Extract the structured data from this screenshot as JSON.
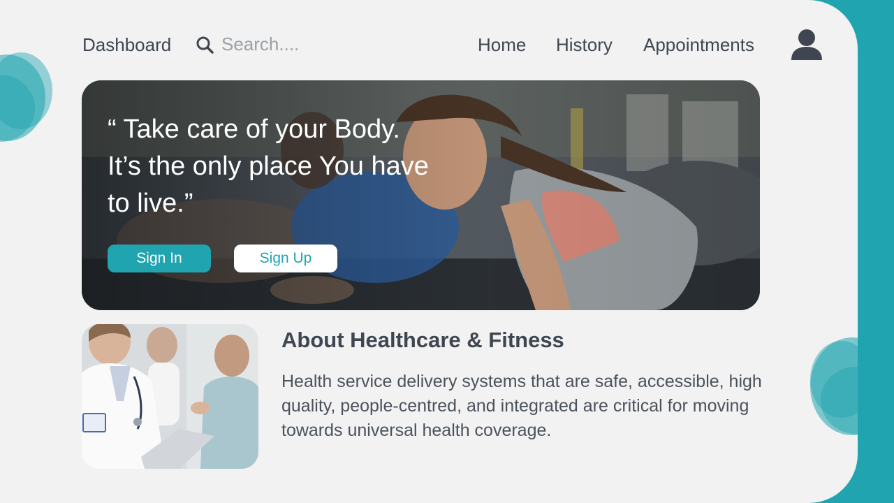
{
  "colors": {
    "accent": "#20a4b0",
    "panel": "#f2f2f2",
    "text": "#3f4651"
  },
  "nav": {
    "dashboard": "Dashboard",
    "search_placeholder": "Search....",
    "links": [
      "Home",
      "History",
      "Appointments"
    ],
    "user_icon": "user-icon"
  },
  "hero": {
    "quote": "“ Take care of your Body. It’s the only place You have to live.”",
    "sign_in": "Sign In",
    "sign_up": "Sign Up"
  },
  "about": {
    "title": "About Healthcare & Fitness",
    "body": "Health service delivery systems that are safe, accessible, high quality, people-centred, and integrated are critical for moving towards universal health coverage."
  }
}
